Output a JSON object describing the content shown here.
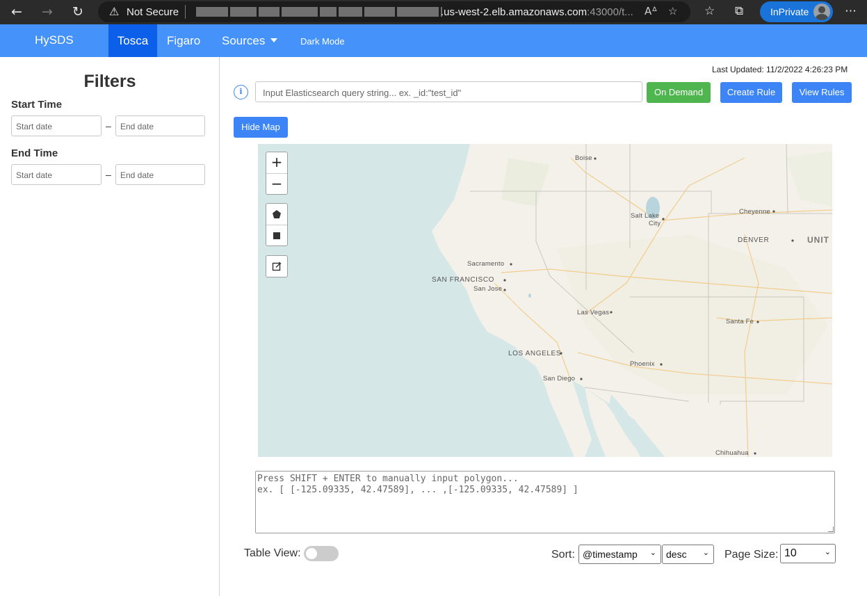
{
  "browser": {
    "security_label": "Not Secure",
    "url_visible": ".us-west-2.elb.amazonaws.com",
    "url_port": ":43000/t...",
    "inprivate_label": "InPrivate"
  },
  "navbar": {
    "brand": "HySDS",
    "tabs": [
      {
        "label": "Tosca",
        "active": true
      },
      {
        "label": "Figaro",
        "active": false
      },
      {
        "label": "Sources",
        "active": false
      }
    ],
    "dark_mode": "Dark Mode"
  },
  "sidebar": {
    "title": "Filters",
    "start_time": {
      "label": "Start Time",
      "start_placeholder": "Start date",
      "end_placeholder": "End date"
    },
    "end_time": {
      "label": "End Time",
      "start_placeholder": "Start date",
      "end_placeholder": "End date"
    },
    "dash": "–"
  },
  "main": {
    "last_updated": "Last Updated: 11/2/2022 4:26:23 PM",
    "query_placeholder": "Input Elasticsearch query string... ex. _id:\"test_id\"",
    "buttons": {
      "on_demand": "On Demand",
      "create_rule": "Create Rule",
      "view_rules": "View Rules",
      "hide_map": "Hide Map"
    },
    "map": {
      "zoom_in": "+",
      "zoom_out": "−",
      "labels": {
        "boise": "Boise",
        "salt_lake_1": "Salt Lake",
        "salt_lake_2": "City",
        "cheyenne": "Cheyenne",
        "denver": "DENVER",
        "united": "UNIT",
        "sacramento": "Sacramento",
        "san_francisco": "SAN FRANCISCO",
        "san_jose": "San Jose",
        "las_vegas": "Las Vegas",
        "santa_fe": "Santa Fe",
        "los_angeles": "LOS ANGELES",
        "phoenix": "Phoenix",
        "san_diego": "San Diego",
        "chihuahua": "Chihuahua"
      }
    },
    "polygon_placeholder_line1": "Press SHIFT + ENTER to manually input polygon...",
    "polygon_placeholder_line2": "ex. [ [-125.09335, 42.47589], ... ,[-125.09335, 42.47589] ]",
    "table_view_label": "Table View:",
    "sort_label": "Sort:",
    "sort_field": "@timestamp",
    "sort_order": "desc",
    "page_size_label": "Page Size:",
    "page_size": "10"
  }
}
